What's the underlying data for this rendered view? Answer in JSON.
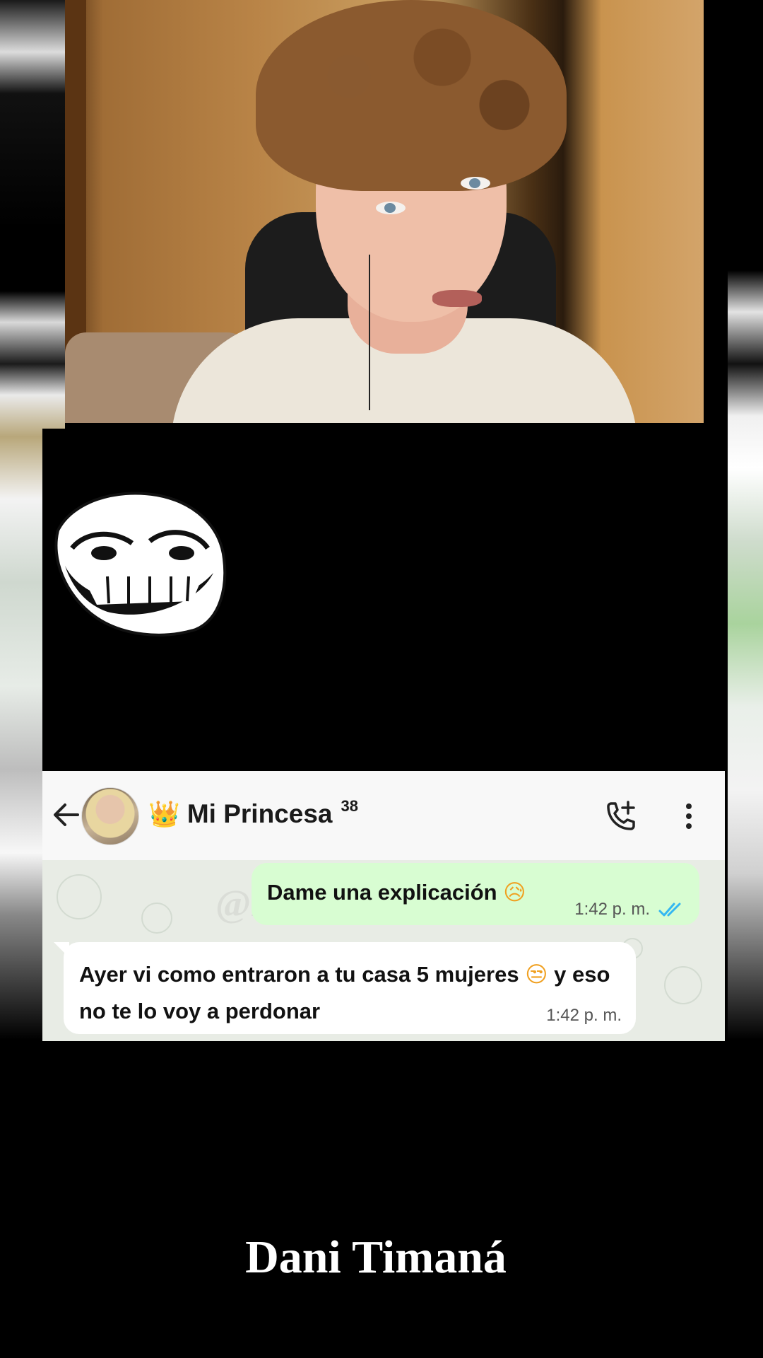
{
  "header": {
    "contact_name": "Mi Princesa",
    "contact_superscript": "38",
    "crown_icon": "👑"
  },
  "messages": [
    {
      "direction": "outgoing",
      "text": "Dame una explicación",
      "emoji": "😥",
      "time": "1:42 p. m.",
      "status": "read"
    },
    {
      "direction": "incoming",
      "text_before": "Ayer vi como entraron a tu casa 5 mujeres",
      "emoji": "😒",
      "text_after": "y eso no te lo voy a perdonar",
      "time": "1:42 p. m."
    }
  ],
  "watermark": "@Dani Timaná",
  "caption": "Dani Timaná",
  "colors": {
    "header_bg": "#f8f8f8",
    "chat_bg": "#e8ece5",
    "outgoing_bubble": "#d8fdd2",
    "incoming_bubble": "#ffffff",
    "read_ticks": "#34b7f1"
  },
  "icons": [
    "back-arrow-icon",
    "add-call-icon",
    "more-vert-icon",
    "double-check-icon",
    "troll-face-sticker"
  ]
}
